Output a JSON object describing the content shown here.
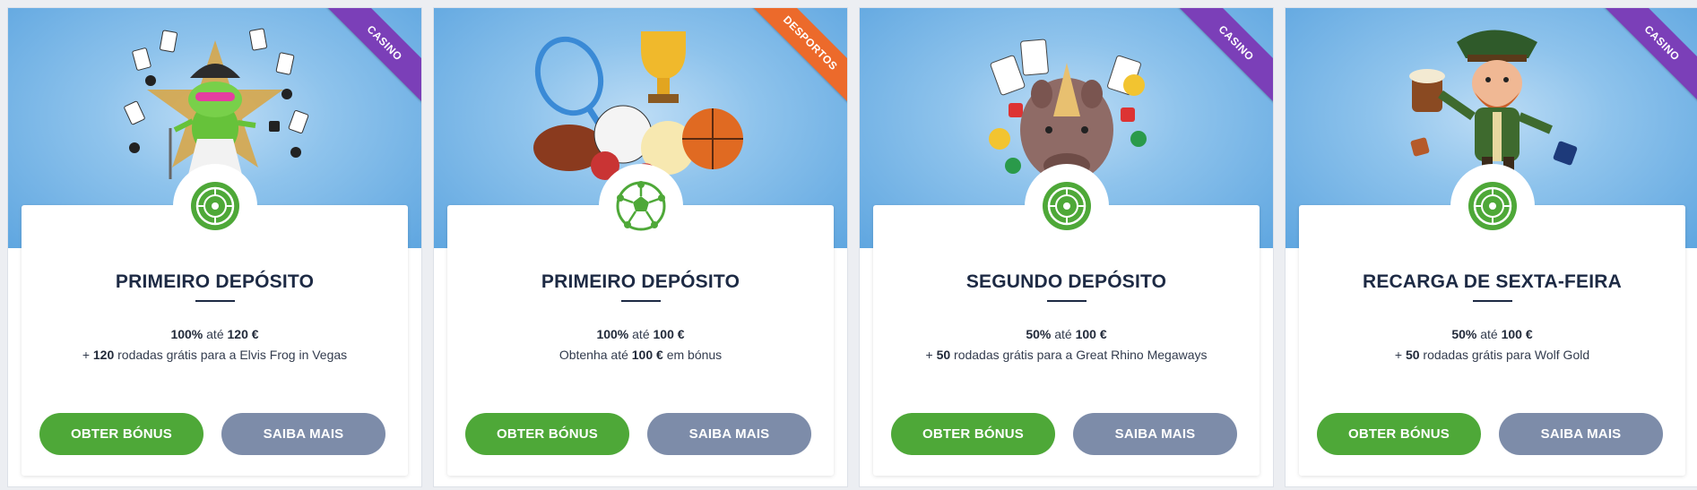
{
  "colors": {
    "primary_button": "#4ea838",
    "secondary_button": "#7d8ca9",
    "casino_ribbon": "#7b3fb8",
    "sport_ribbon": "#ec6a2b",
    "title_text": "#1d2a44",
    "banner_blue": "#5fa6e0"
  },
  "cards": [
    {
      "ribbon": "CASINO",
      "ribbon_type": "casino",
      "art": "frog-character-with-cards-illustration",
      "badge_icon": "roulette-icon",
      "title": "PRIMEIRO DEPÓSITO",
      "line1": {
        "pre": "",
        "b1": "100%",
        "mid": " até ",
        "b2": "120 €",
        "post": ""
      },
      "line2": {
        "pre": "+ ",
        "b1": "120",
        "post": " rodadas grátis para a Elvis Frog in Vegas"
      },
      "primary_label": "OBTER BÓNUS",
      "secondary_label": "SAIBA MAIS"
    },
    {
      "ribbon": "DESPORTOS",
      "ribbon_type": "sport",
      "art": "sports-balls-trophy-racket-illustration",
      "badge_icon": "soccer-ball-icon",
      "title": "PRIMEIRO DEPÓSITO",
      "line1": {
        "pre": "",
        "b1": "100%",
        "mid": " até ",
        "b2": "100 €",
        "post": ""
      },
      "line2": {
        "pre": "Obtenha até ",
        "b1": "100 €",
        "post": " em bónus"
      },
      "primary_label": "OBTER BÓNUS",
      "secondary_label": "SAIBA MAIS"
    },
    {
      "ribbon": "CASINO",
      "ribbon_type": "casino",
      "art": "rhino-with-cards-coins-illustration",
      "badge_icon": "roulette-icon",
      "title": "SEGUNDO DEPÓSITO",
      "line1": {
        "pre": "",
        "b1": "50%",
        "mid": " até ",
        "b2": "100 €",
        "post": ""
      },
      "line2": {
        "pre": "+ ",
        "b1": "50",
        "post": " rodadas grátis para a Great Rhino Megaways"
      },
      "primary_label": "OBTER BÓNUS",
      "secondary_label": "SAIBA MAIS"
    },
    {
      "ribbon": "CASINO",
      "ribbon_type": "casino",
      "art": "leprechaun-with-beer-and-dice-illustration",
      "badge_icon": "roulette-icon",
      "title": "RECARGA DE SEXTA-FEIRA",
      "line1": {
        "pre": "",
        "b1": "50%",
        "mid": " até ",
        "b2": "100 €",
        "post": ""
      },
      "line2": {
        "pre": "+ ",
        "b1": "50",
        "post": " rodadas grátis para Wolf Gold"
      },
      "primary_label": "OBTER BÓNUS",
      "secondary_label": "SAIBA MAIS"
    }
  ]
}
